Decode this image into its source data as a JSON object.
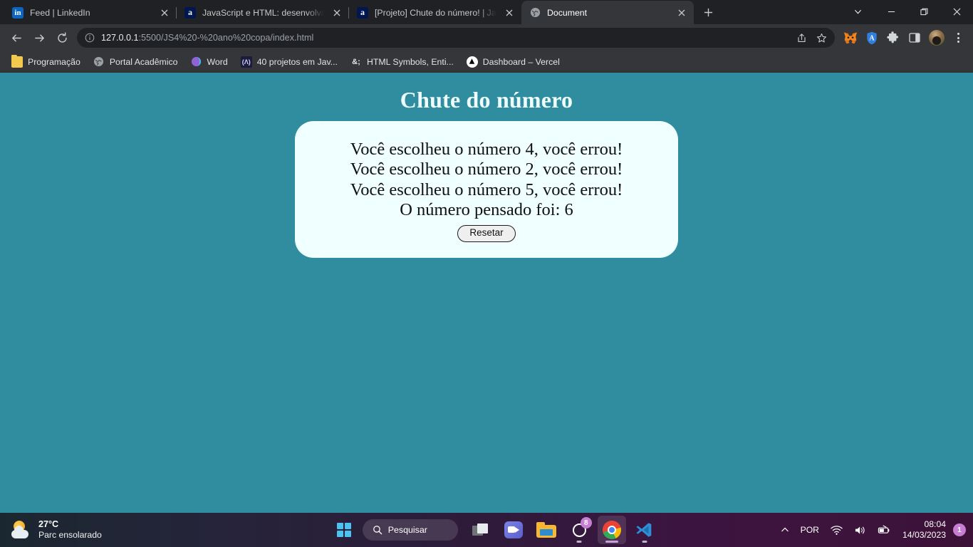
{
  "browser": {
    "tabs": [
      {
        "title": "Feed | LinkedIn",
        "favicon": "linkedin-icon",
        "active": false
      },
      {
        "title": "JavaScript e HTML: desenvolva u",
        "favicon": "alura-icon",
        "active": false
      },
      {
        "title": "[Projeto] Chute do número! | Java",
        "favicon": "alura-icon",
        "active": false
      },
      {
        "title": "Document",
        "favicon": "globe-icon",
        "active": true
      }
    ],
    "new_tab_label": "+",
    "window_controls": {
      "tab_search": "tab-search-chevron",
      "minimize": "minimize",
      "maximize": "maximize",
      "close": "close"
    },
    "toolbar": {
      "back": "back-arrow",
      "forward": "forward-arrow",
      "reload": "reload",
      "url_host": "127.0.0.1",
      "url_path": ":5500/JS4%20-%20ano%20copa/index.html",
      "url_full": "127.0.0.1:5500/JS4%20-%20ano%20copa/index.html",
      "site_info": "info-circle-icon",
      "share": "share-icon",
      "bookmark": "star-icon",
      "extensions": [
        {
          "name": "metamask-icon"
        },
        {
          "name": "shield-extension-icon"
        },
        {
          "name": "puzzle-extensions-icon"
        },
        {
          "name": "side-panel-icon"
        }
      ],
      "profile": "avatar",
      "menu": "kebab-menu-icon"
    },
    "bookmarks": [
      {
        "label": "Programação",
        "icon": "folder-icon"
      },
      {
        "label": "Portal Acadêmico",
        "icon": "globe-icon"
      },
      {
        "label": "Word",
        "icon": "word-icon"
      },
      {
        "label": "40 projetos em Jav...",
        "icon": "project-icon"
      },
      {
        "label": "HTML Symbols, Enti...",
        "icon": "ampersand-icon"
      },
      {
        "label": "Dashboard – Vercel",
        "icon": "vercel-triangle-icon"
      }
    ]
  },
  "page": {
    "title": "Chute do número",
    "background_color": "#2f8d9f",
    "card_color": "#f0ffff",
    "lines": [
      "Você escolheu o número 4, você errou!",
      "Você escolheu o número 2, você errou!",
      "Você escolheu o número 5, você errou!",
      "O número pensado foi: 6"
    ],
    "reset_button": "Resetar"
  },
  "taskbar": {
    "weather": {
      "temperature": "27°C",
      "description": "Parc ensolarado",
      "icon": "sun-cloud-icon"
    },
    "start": "windows-start-icon",
    "search_placeholder": "Pesquisar",
    "apps": [
      {
        "name": "task-view-icon",
        "badge": null,
        "active": false,
        "running": false
      },
      {
        "name": "teams-icon",
        "badge": null,
        "active": false,
        "running": false
      },
      {
        "name": "file-explorer-icon",
        "badge": null,
        "active": false,
        "running": false
      },
      {
        "name": "whatsapp-icon",
        "badge": "8",
        "active": false,
        "running": true
      },
      {
        "name": "chrome-icon",
        "badge": null,
        "active": true,
        "running": true
      },
      {
        "name": "vscode-icon",
        "badge": null,
        "active": false,
        "running": true
      }
    ],
    "tray": {
      "overflow": "show-hidden-icons-chevron",
      "language": "POR",
      "wifi": "wifi-icon",
      "volume": "volume-icon",
      "battery": "battery-icon",
      "time": "08:04",
      "date": "14/03/2023",
      "notifications": "1"
    }
  }
}
